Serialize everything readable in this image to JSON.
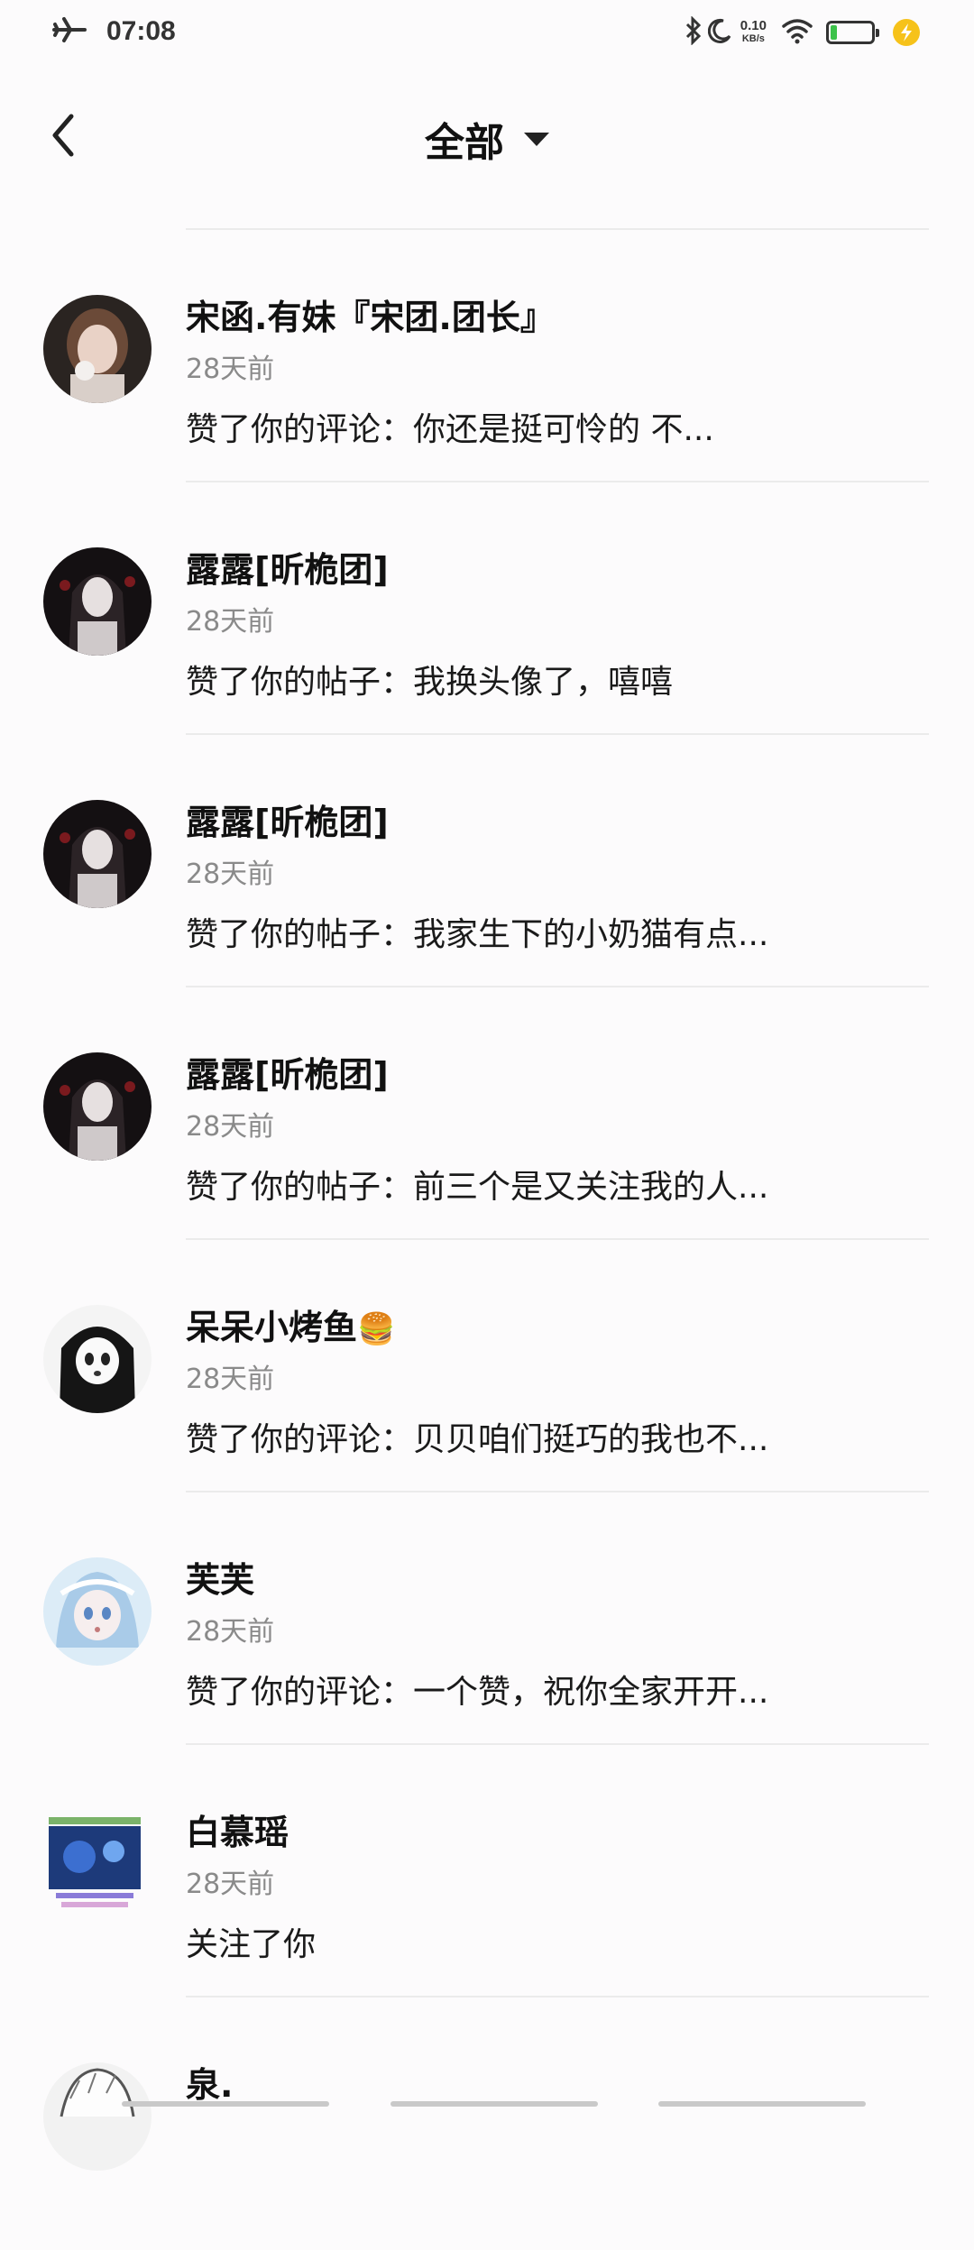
{
  "status_bar": {
    "time": "07:08",
    "net_speed_value": "0.10",
    "net_speed_unit": "KB/s",
    "battery_level": 0.15,
    "icons": [
      "airplane-icon",
      "bluetooth-icon",
      "moon-icon",
      "wifi-icon",
      "battery-icon",
      "charging-icon"
    ]
  },
  "header": {
    "title": "全部"
  },
  "colors": {
    "background": "#fcfbfc",
    "divider": "#ebebeb",
    "time_text": "#8a8a8a",
    "battery_fill": "#3cc24a",
    "charge": "#f6c21a"
  },
  "notifications": [
    {
      "name": "宋函.有妹『宋团.团长』",
      "time": "28天前",
      "action": "赞了你的评论：你还是挺可怜的  不..."
    },
    {
      "name": "露露[昕桅团]",
      "time": "28天前",
      "action": "赞了你的帖子：我换头像了，嘻嘻"
    },
    {
      "name": "露露[昕桅团]",
      "time": "28天前",
      "action": "赞了你的帖子：我家生下的小奶猫有点..."
    },
    {
      "name": "露露[昕桅团]",
      "time": "28天前",
      "action": "赞了你的帖子：前三个是又关注我的人..."
    },
    {
      "name": "呆呆小烤鱼",
      "name_emoji": "🍔",
      "time": "28天前",
      "action": "赞了你的评论：贝贝咱们挺巧的我也不..."
    },
    {
      "name": "芙芙",
      "time": "28天前",
      "action": "赞了你的评论：一个赞，祝你全家开开..."
    },
    {
      "name": "白慕瑶",
      "time": "28天前",
      "action": "关注了你"
    },
    {
      "name": "泉.",
      "time": "",
      "action": ""
    }
  ]
}
